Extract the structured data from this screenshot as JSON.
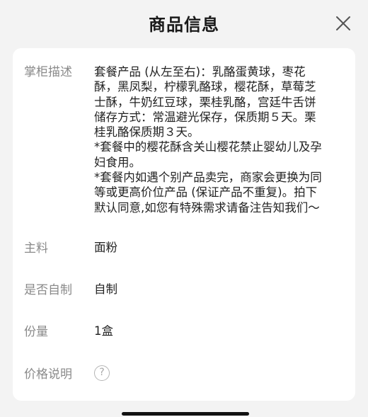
{
  "header": {
    "title": "商品信息"
  },
  "description": {
    "label": "掌柜描述",
    "lines": [
      "套餐产品 (从左至右)：乳酪蛋黄球，枣花",
      "酥，黑凤梨，柠檬乳酪球，樱花酥，草莓芝",
      "士酥，牛奶红豆球，栗桂乳酪，宫廷牛舌饼",
      "储存方式：常温避光保存，保质期５天。栗",
      "桂乳酪保质期３天。",
      "*套餐中的樱花酥含关山樱花禁止婴幼儿及孕",
      "妇食用。",
      "*套餐内如遇个别产品卖完，商家会更换为同",
      "等或更高价位产品 (保证产品不重复)。拍下",
      "默认同意,如您有特殊需求请备注告知我们～"
    ]
  },
  "main_ingredient": {
    "label": "主料",
    "value": "面粉"
  },
  "self_made": {
    "label": "是否自制",
    "value": "自制"
  },
  "quantity": {
    "label": "份量",
    "value": "1盒"
  },
  "price_note": {
    "label": "价格说明",
    "help_glyph": "?"
  },
  "icons": {
    "close": "close-icon",
    "help": "question-circle-icon"
  }
}
